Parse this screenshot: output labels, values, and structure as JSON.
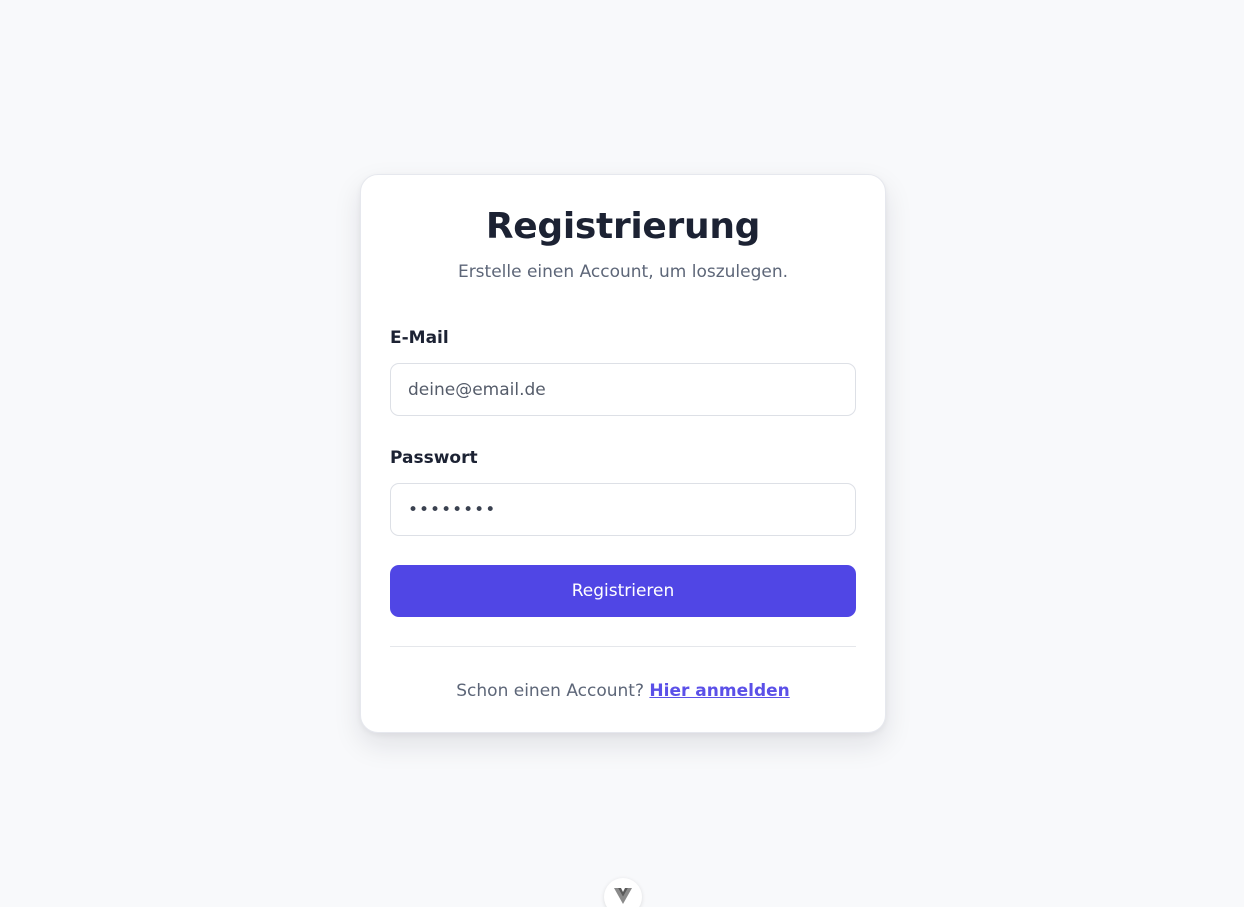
{
  "form": {
    "title": "Registrierung",
    "subtitle": "Erstelle einen Account, um loszulegen.",
    "email": {
      "label": "E-Mail",
      "placeholder": "deine@email.de"
    },
    "password": {
      "label": "Passwort",
      "value": "••••••••"
    },
    "submit_label": "Registrieren",
    "footer": {
      "text": "Schon einen Account? ",
      "link_label": "Hier anmelden"
    }
  },
  "colors": {
    "accent": "#5046e5",
    "background": "#f8f9fb",
    "link": "#5b50e8"
  },
  "icons": {
    "floating_button": "vue-logo-icon"
  }
}
